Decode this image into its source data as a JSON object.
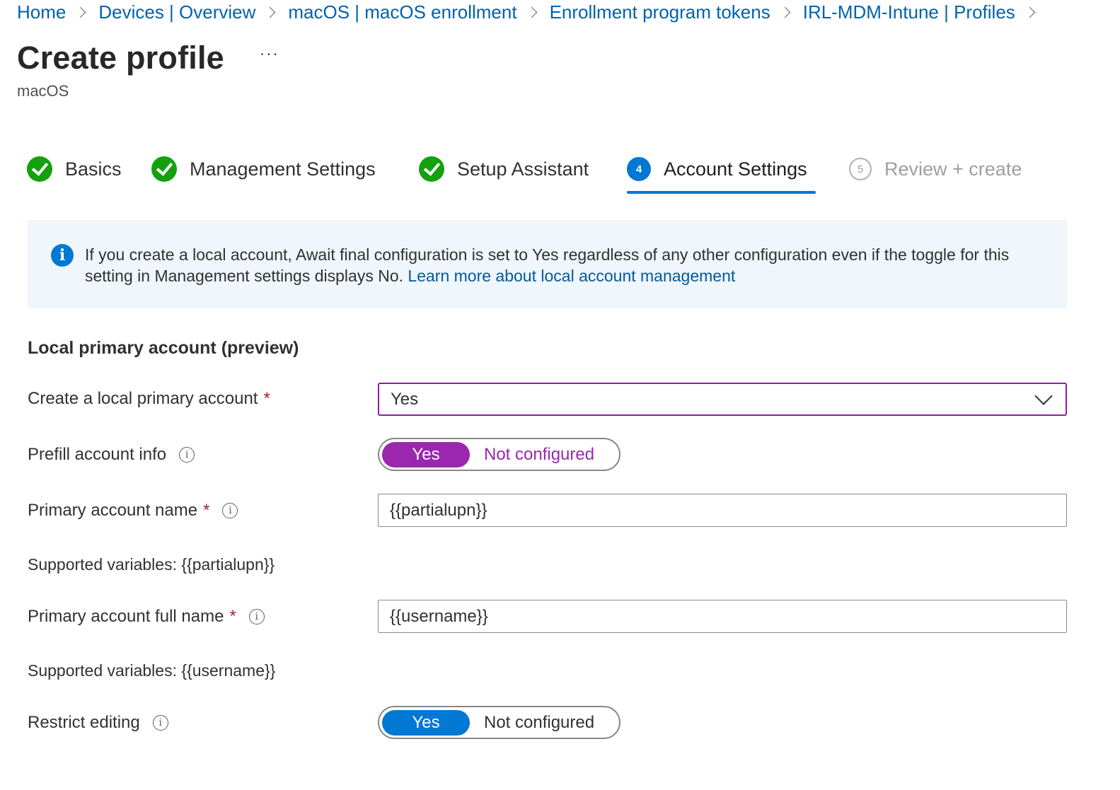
{
  "breadcrumb": [
    "Home",
    "Devices | Overview",
    "macOS | macOS enrollment",
    "Enrollment program tokens",
    "IRL-MDM-Intune | Profiles"
  ],
  "header": {
    "title": "Create profile",
    "more": "···",
    "subtitle": "macOS"
  },
  "steps": [
    {
      "label": "Basics",
      "state": "complete"
    },
    {
      "label": "Management Settings",
      "state": "complete"
    },
    {
      "label": "Setup Assistant",
      "state": "complete"
    },
    {
      "label": "Account Settings",
      "state": "active",
      "number": "4"
    },
    {
      "label": "Review + create",
      "state": "inactive",
      "number": "5"
    }
  ],
  "info": {
    "icon": "i",
    "text": "If you create a local account, Await final configuration is set to Yes regardless of any other configuration even if the toggle for this setting in Management settings displays No.",
    "link": "Learn more about local account management"
  },
  "section": {
    "title": "Local primary account (preview)"
  },
  "fields": {
    "create_local": {
      "label": "Create a local primary account",
      "required": "*",
      "value": "Yes"
    },
    "prefill": {
      "label": "Prefill account info",
      "on_label": "Yes",
      "off_label": "Not configured",
      "color": "#9b27af"
    },
    "account_name": {
      "label": "Primary account name",
      "required": "*",
      "value": "{{partialupn}}",
      "hint": "Supported variables: {{partialupn}}"
    },
    "full_name": {
      "label": "Primary account full name",
      "required": "*",
      "value": "{{username}}",
      "hint": "Supported variables: {{username}}"
    },
    "restrict": {
      "label": "Restrict editing",
      "on_label": "Yes",
      "off_label": "Not configured",
      "color": "#0078d4"
    }
  },
  "colors": {
    "link": "#0062ad",
    "accent": "#0078d4",
    "success": "#13a10e",
    "purple": "#9b27af",
    "info_bg": "#eff6fc"
  }
}
